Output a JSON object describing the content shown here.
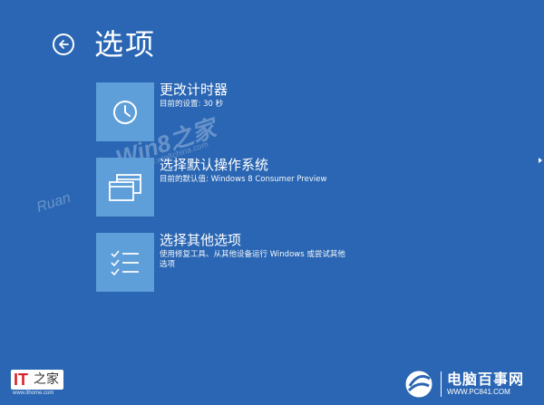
{
  "header": {
    "back_icon": "back-arrow-icon",
    "title": "选项"
  },
  "options": [
    {
      "icon": "clock-icon",
      "title": "更改计时器",
      "desc": "目前的设置: 30 秒"
    },
    {
      "icon": "windows-icon",
      "title": "选择默认操作系统",
      "desc": "目前的默认值: Windows 8 Consumer Preview"
    },
    {
      "icon": "checklist-icon",
      "title": "选择其他选项",
      "desc": "使用修复工具、从其他设备运行 Windows 或尝试其他选项"
    }
  ],
  "watermark": {
    "main": "Win8之家",
    "url": "www.win8china.com",
    "left": "Ruan"
  },
  "logos": {
    "left_it": "IT",
    "left_cn": "之家",
    "left_site": "www.ithome.com",
    "right_cn": "电脑百事网",
    "right_url": "WWW.PC841.COM"
  },
  "colors": {
    "background": "#2a66b3",
    "tile": "#5e9ed9",
    "text": "#ffffff"
  }
}
